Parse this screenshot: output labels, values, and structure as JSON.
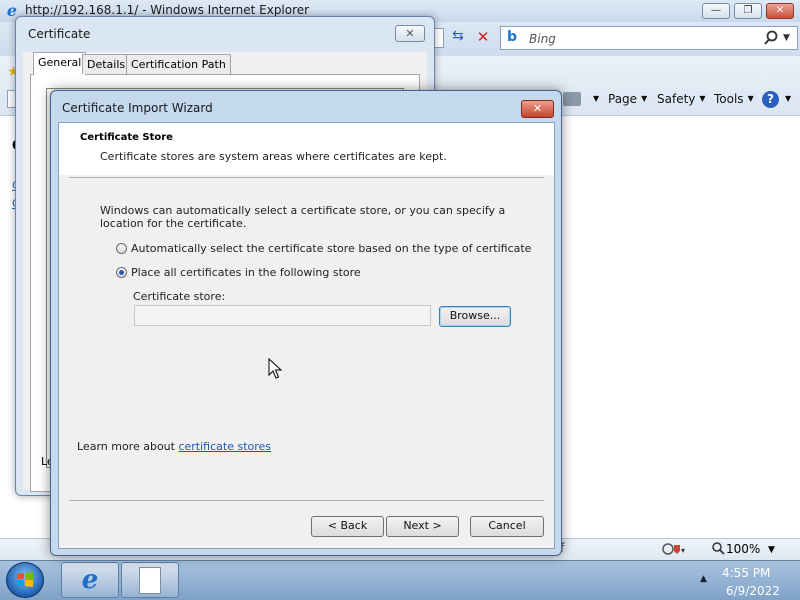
{
  "browser": {
    "title": "http://192.168.1.1/ - Windows Internet Explorer",
    "logo_letter": "e",
    "search_brand_letter": "b",
    "search_placeholder": "Bing",
    "commands": {
      "page": "Page",
      "safety": "Safety",
      "tools": "Tools",
      "help": "?"
    },
    "zoom": "100%",
    "status_fragment": "f",
    "window_buttons": {
      "minimize": "—",
      "restore": "❐",
      "close": "✕"
    }
  },
  "certificate_dialog": {
    "title": "Certificate",
    "close": "✕",
    "tabs": [
      "General",
      "Details",
      "Certification Path"
    ],
    "partial_text": "Le"
  },
  "background_page": {
    "heading_fragment": "C",
    "link1_fragment": "C",
    "link2_fragment": "C"
  },
  "wizard": {
    "title": "Certificate Import Wizard",
    "close": "✕",
    "heading": "Certificate Store",
    "subheading": "Certificate stores are system areas where certificates are kept.",
    "description": "Windows can automatically select a certificate store, or you can specify a location for the certificate.",
    "options": [
      {
        "label": "Automatically select the certificate store based on the type of certificate",
        "selected": false
      },
      {
        "label": "Place all certificates in the following store",
        "selected": true
      }
    ],
    "store_label": "Certificate store:",
    "store_value": "",
    "browse_label": "Browse...",
    "learn_prefix": "Learn more about ",
    "learn_link": "certificate stores",
    "back_label": "< Back",
    "next_label": "Next >",
    "cancel_label": "Cancel"
  },
  "taskbar": {
    "ie_letter": "e",
    "tray_arrow": "▲",
    "time": "4:55 PM",
    "date": "6/9/2022"
  },
  "colors": {
    "accent": "#1c57b3",
    "taskbar": "#7fa2c8",
    "close_red": "#c4442c"
  },
  "icons": [
    "ie-logo-icon",
    "search-icon",
    "refresh-icon",
    "stop-icon",
    "favorites-star-icon",
    "printer-icon",
    "help-icon",
    "zoom-icon",
    "windows-start-icon",
    "document-icon",
    "mouse-cursor-icon"
  ]
}
